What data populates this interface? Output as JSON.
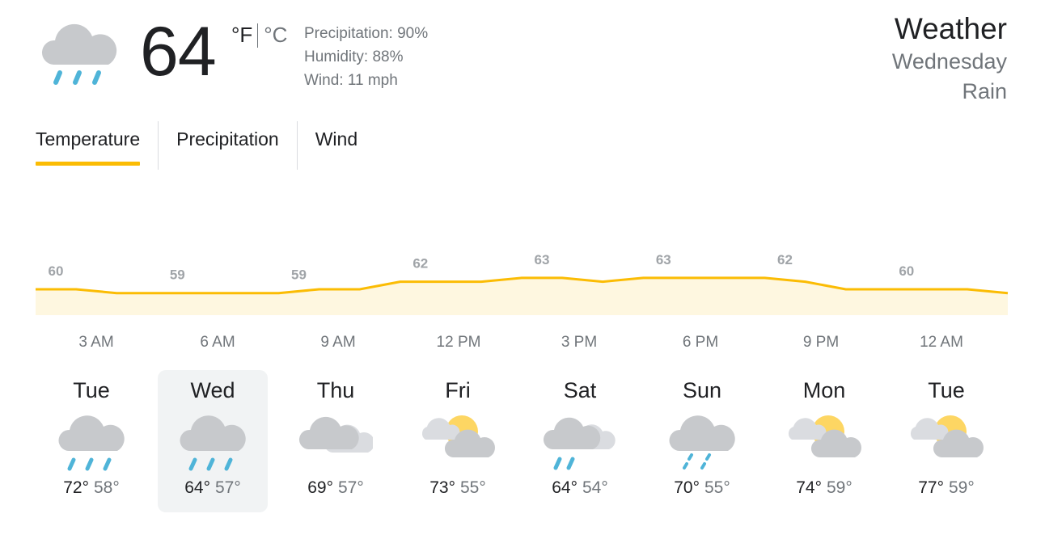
{
  "current": {
    "temperature": "64",
    "unit_f": "°F",
    "unit_c": "°C",
    "condition_icon": "rain-icon",
    "precipitation": "Precipitation: 90%",
    "humidity": "Humidity: 88%",
    "wind": "Wind: 11 mph"
  },
  "header": {
    "title": "Weather",
    "day": "Wednesday",
    "condition": "Rain"
  },
  "tabs": [
    {
      "label": "Temperature",
      "active": true
    },
    {
      "label": "Precipitation",
      "active": false
    },
    {
      "label": "Wind",
      "active": false
    }
  ],
  "colors": {
    "accent": "#fbbc04",
    "area_fill": "#fef7e0",
    "label_gray": "#a0a4a8"
  },
  "chart_data": {
    "type": "area",
    "values": [
      60,
      60,
      59,
      59,
      59,
      59,
      59,
      60,
      60,
      62,
      62,
      62,
      63,
      63,
      62,
      63,
      63,
      63,
      63,
      62,
      60,
      60,
      60,
      60,
      59,
      59
    ],
    "labels": [
      {
        "index": 0,
        "value": "60"
      },
      {
        "index": 3,
        "value": "59"
      },
      {
        "index": 6,
        "value": "59"
      },
      {
        "index": 9,
        "value": "62"
      },
      {
        "index": 12,
        "value": "63"
      },
      {
        "index": 15,
        "value": "63"
      },
      {
        "index": 18,
        "value": "62"
      },
      {
        "index": 21,
        "value": "60"
      }
    ],
    "ylim": [
      55,
      70
    ],
    "grid": false
  },
  "times": [
    "3 AM",
    "6 AM",
    "9 AM",
    "12 PM",
    "3 PM",
    "6 PM",
    "9 PM",
    "12 AM"
  ],
  "forecast": [
    {
      "day": "Tue",
      "icon": "rain-icon",
      "high": "72°",
      "low": "58°",
      "selected": false
    },
    {
      "day": "Wed",
      "icon": "rain-icon",
      "high": "64°",
      "low": "57°",
      "selected": true
    },
    {
      "day": "Thu",
      "icon": "cloudy-icon",
      "high": "69°",
      "low": "57°",
      "selected": false
    },
    {
      "day": "Fri",
      "icon": "partly-cloudy-icon",
      "high": "73°",
      "low": "55°",
      "selected": false
    },
    {
      "day": "Sat",
      "icon": "scattered-showers-icon",
      "high": "64°",
      "low": "54°",
      "selected": false
    },
    {
      "day": "Sun",
      "icon": "light-rain-icon",
      "high": "70°",
      "low": "55°",
      "selected": false
    },
    {
      "day": "Mon",
      "icon": "partly-cloudy-icon",
      "high": "74°",
      "low": "59°",
      "selected": false
    },
    {
      "day": "Tue",
      "icon": "partly-cloudy-icon",
      "high": "77°",
      "low": "59°",
      "selected": false
    }
  ]
}
